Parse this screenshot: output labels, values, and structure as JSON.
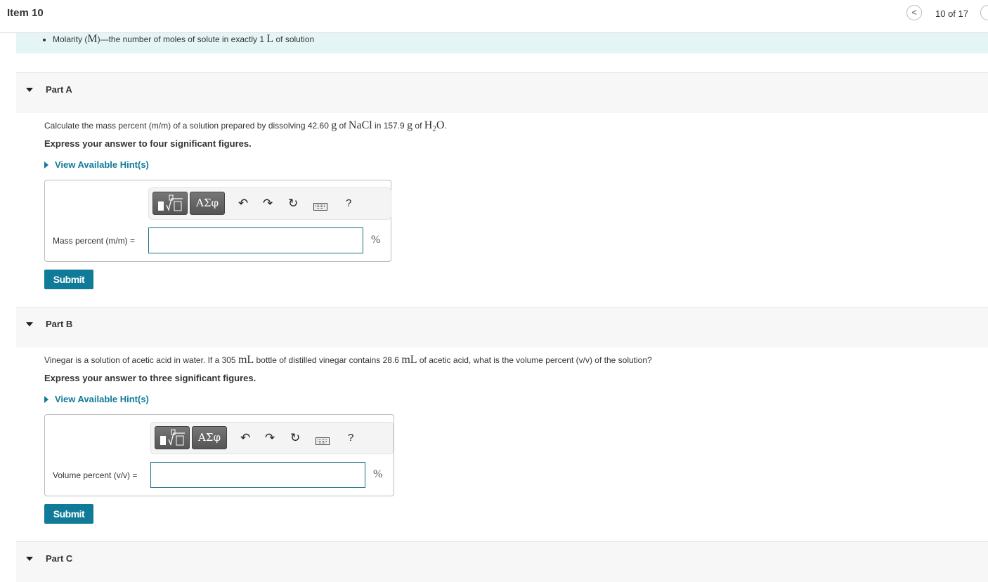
{
  "header": {
    "item_title": "Item 10",
    "nav_prev_icon": "<",
    "position": "10 of 17"
  },
  "intro": {
    "bullet_pre": "Molarity (",
    "bullet_sym": "M",
    "bullet_mid": ")—the number of moles of solute in exactly 1 ",
    "bullet_unit": "L",
    "bullet_post": " of solution"
  },
  "toolbar": {
    "greek_label": "ΑΣφ",
    "undo_icon": "↶",
    "redo_icon": "↷",
    "reset_icon": "↻",
    "help_label": "?"
  },
  "parts": [
    {
      "label": "Part A",
      "q_pre": "Calculate the mass percent (m/m) of a solution prepared by dissolving 42.60 ",
      "q_u1": "g",
      "q_mid1": " of ",
      "q_chem1": "NaCl",
      "q_mid2": " in 157.9 ",
      "q_u2": "g",
      "q_mid3": " of ",
      "q_chem2_a": "H",
      "q_chem2_sub": "2",
      "q_chem2_b": "O",
      "q_end": ".",
      "instruction": "Express your answer to four significant figures.",
      "hint": "View Available Hint(s)",
      "field_label": "Mass percent (m/m) =",
      "value": "",
      "unit": "%",
      "submit": "Submit"
    },
    {
      "label": "Part B",
      "q_pre": "Vinegar is a solution of acetic acid in water. If a 305 ",
      "q_u1": "mL",
      "q_mid1": " bottle of distilled vinegar contains 28.6 ",
      "q_u2": "mL",
      "q_end": " of acetic acid, what is the volume percent (v/v) of the solution?",
      "instruction": "Express your answer to three significant figures.",
      "hint": "View Available Hint(s)",
      "field_label": "Volume percent (v/v) =",
      "value": "",
      "unit": "%",
      "submit": "Submit"
    },
    {
      "label": "Part C"
    }
  ]
}
